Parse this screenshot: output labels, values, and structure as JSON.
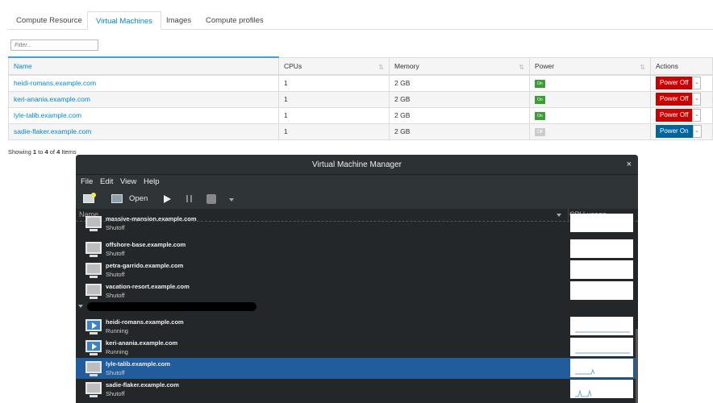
{
  "tabs": [
    "Compute Resource",
    "Virtual Machines",
    "Images",
    "Compute profiles"
  ],
  "active_tab": "Virtual Machines",
  "filter": {
    "placeholder": "Filter..."
  },
  "table": {
    "columns": [
      "Name",
      "CPUs",
      "Memory",
      "Power",
      "Actions"
    ],
    "rows": [
      {
        "name": "heidi-romans.example.com",
        "cpus": "1",
        "memory": "2 GB",
        "power": "On",
        "action": "Power Off"
      },
      {
        "name": "keri-anania.example.com",
        "cpus": "1",
        "memory": "2 GB",
        "power": "On",
        "action": "Power Off"
      },
      {
        "name": "lyle-talib.example.com",
        "cpus": "1",
        "memory": "2 GB",
        "power": "On",
        "action": "Power Off"
      },
      {
        "name": "sadie-flaker.example.com",
        "cpus": "1",
        "memory": "2 GB",
        "power": "Off",
        "action": "Power On"
      }
    ]
  },
  "pagination": {
    "prefix": "Showing ",
    "from": "1",
    "to_word": " to ",
    "to": "4",
    "of_word": " of ",
    "total": "4",
    "suffix": " Items"
  },
  "vmm": {
    "title": "Virtual Machine Manager",
    "close": "×",
    "menu": [
      "File",
      "Edit",
      "View",
      "Help"
    ],
    "open_label": "Open",
    "col_name": "Name",
    "col_cpu": "CPU usage",
    "vms": [
      {
        "name": "massive-mansion.example.com",
        "status": "Shutoff"
      },
      {
        "name": "offshore-base.example.com",
        "status": "Shutoff"
      },
      {
        "name": "petra-garrido.example.com",
        "status": "Shutoff"
      },
      {
        "name": "vacation-resort.example.com",
        "status": "Shutoff"
      },
      {
        "name": "heidi-romans.example.com",
        "status": "Running"
      },
      {
        "name": "keri-anania.example.com",
        "status": "Running"
      },
      {
        "name": "lyle-talib.example.com",
        "status": "Shutoff"
      },
      {
        "name": "sadie-flaker.example.com",
        "status": "Shutoff"
      }
    ],
    "selected": "lyle-talib.example.com"
  },
  "colors": {
    "accent": "#0088ce",
    "power_off": "#cc0000",
    "power_on": "#00659c",
    "on_badge": "#3f9c35",
    "selection": "#215d9c"
  }
}
